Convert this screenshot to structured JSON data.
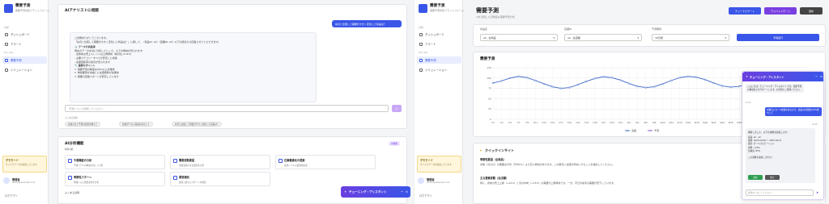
{
  "app": {
    "name": "需要予測",
    "subtitle": "需要予測支援プラットフォーム"
  },
  "sidebar": {
    "section1": "分析",
    "items": [
      {
        "label": "ダッシュボード"
      },
      {
        "label": "アラート"
      },
      {
        "label": "需要予測"
      },
      {
        "label": "シミュレーション"
      }
    ],
    "section2": "Pro Use",
    "note_title": "デモモード",
    "note_text": "サンプルデータを使用しています",
    "user_name": "管理者",
    "user_email": "admin@example.com",
    "logout": "ログアウト"
  },
  "left": {
    "chat_title": "AIアナリストに相談",
    "user_question": "先月と比較して需要が大きく変化した商品は？",
    "answer_lines": [
      "ご質問ありがとうございます。",
      "「先月と比較して需要が大きく変化した商品は？」に関して、（商品ID: all）（店舗ID: all）以下の観点から回答させていただきます。",
      "📊 データ分析結果",
      "現在のデータを基に分析したところ、以下の傾向が見られます：",
      "- 全体的な売上トレンドは上昇傾向（前月比+5.8%）",
      "- 主要カテゴリーすべてが安定した成長",
      "- 在庫回転率の改善が見られます",
      "🔍 重要なポイント",
      "1. 需要予測の精度は90%以上を維持",
      "2. 季節要因を考慮した在庫調整が効果的",
      "3. 需要の変動パターンが安定しています"
    ],
    "input_placeholder": "予測について質問してください...",
    "suggest_label": "よくある質問",
    "suggestions": [
      "先週の売上予測の結果を教えて",
      "在庫が少ない商品を表示して",
      "先月と比較して需要が大きく変化した商品は？"
    ],
    "ai_title": "AI分析機能",
    "ai_sub": "利用可能",
    "ai_badge": "新機能",
    "tiles": [
      {
        "title": "予測精度の分析",
        "desc": "予測モデルの精度を詳しく分析"
      },
      {
        "title": "需要変動要因",
        "desc": "需要変動の主な要因を分析"
      },
      {
        "title": "在庫最適化の提案",
        "desc": "在庫レベルの最適化提案"
      },
      {
        "title": "季節性パターン",
        "desc": "季節による需要変化を分析"
      },
      {
        "title": "異常検知",
        "desc": "通常と異なるパターンを検知"
      }
    ],
    "bottom_label": "よくある質問",
    "tuning_label": "チューニング・アシスタント"
  },
  "right": {
    "page_title": "需要予測",
    "page_sub": "AIを活用した高精度な需要予測分析",
    "btn_tune": "チューナビゲート",
    "btn_advice": "アドバイスモード",
    "btn_refresh": "更新",
    "filters": [
      {
        "label": "商品名",
        "value": "all - 全商品"
      },
      {
        "label": "店舗ID",
        "value": "all - 全店舗"
      },
      {
        "label": "予測期間",
        "value": "30日間"
      }
    ],
    "run_button": "予測実行",
    "chart_title": "需要予測",
    "insight_title": "クイックインサイト",
    "insights": [
      {
        "title": "季節性要因（全商品）",
        "text": "水曜（4日/分）の需要は平均（平均5%）より高い傾向があります。この曜日に在庫を厚めにすることを検討してください。"
      },
      {
        "title": "主な要素変動（全店舗）",
        "text": "特に、週末の売上上昇（+10%）と月の中旬（+15%）の需要が上昇傾向です。一方、平日の前半は需要が低下しています。"
      }
    ],
    "assistant": {
      "title": "チューニング・アシスタント",
      "greeting": "こんにちは！チューニング・アシスタントです。需要予測の精度向上をサポートします。お気軽にご質問ください。",
      "time1": "10:45",
      "user_msg": "水曜日にセール施策があるので、商品Aの需要を20%増やして",
      "time2": "10:46",
      "reply_head": "理解しました。以下の調整を提案します：",
      "reply_items": [
        "商品: all - all",
        "期間: 2025-09-08 ～ 2025-09-15",
        "要因: セールプロモーション",
        "調整: +20%",
        "信頼度: 85%"
      ],
      "reply_q": "この調整を適用しますか？",
      "apply": "適用",
      "cancel": "修正",
      "input_placeholder": "質問を入力してください..."
    }
  },
  "chart_data": {
    "type": "line",
    "title": "需要予測",
    "ylim": [
      0,
      125
    ],
    "yticks": [
      0,
      25,
      50,
      75,
      100,
      125
    ],
    "x": [
      "7/1",
      "7/3",
      "7/5",
      "7/7",
      "7/9",
      "7/11",
      "7/13",
      "7/15",
      "7/17",
      "7/19",
      "7/21",
      "7/23",
      "7/25",
      "7/27",
      "7/29",
      "7/31",
      "8/2",
      "8/4",
      "8/6",
      "8/8",
      "8/10",
      "8/12",
      "8/14",
      "8/16",
      "8/18",
      "8/20",
      "8/22",
      "8/24",
      "8/26",
      "8/28",
      "8/30",
      "9/1",
      "9/3",
      "9/5",
      "9/7",
      "9/9",
      "9/11",
      "9/13"
    ],
    "series": [
      {
        "name": "実績",
        "values": [
          88,
          93,
          100,
          104,
          101,
          94,
          86,
          79,
          75,
          77,
          84,
          92,
          99,
          103,
          101,
          95,
          87,
          80,
          77,
          79,
          86,
          94,
          101,
          104,
          102,
          96,
          88,
          81,
          78,
          80,
          87,
          95,
          102,
          105,
          103,
          97,
          89,
          82
        ],
        "color": "#3b64c8"
      },
      {
        "name": "予測",
        "values": [
          null,
          null,
          null,
          null,
          null,
          null,
          null,
          null,
          null,
          null,
          null,
          null,
          null,
          null,
          null,
          null,
          null,
          null,
          null,
          null,
          null,
          null,
          null,
          null,
          null,
          null,
          null,
          null,
          null,
          null,
          null,
          95,
          102,
          105,
          103,
          97,
          89,
          82
        ],
        "color": "#8a4fd8"
      }
    ],
    "legend": "bottom-center"
  }
}
